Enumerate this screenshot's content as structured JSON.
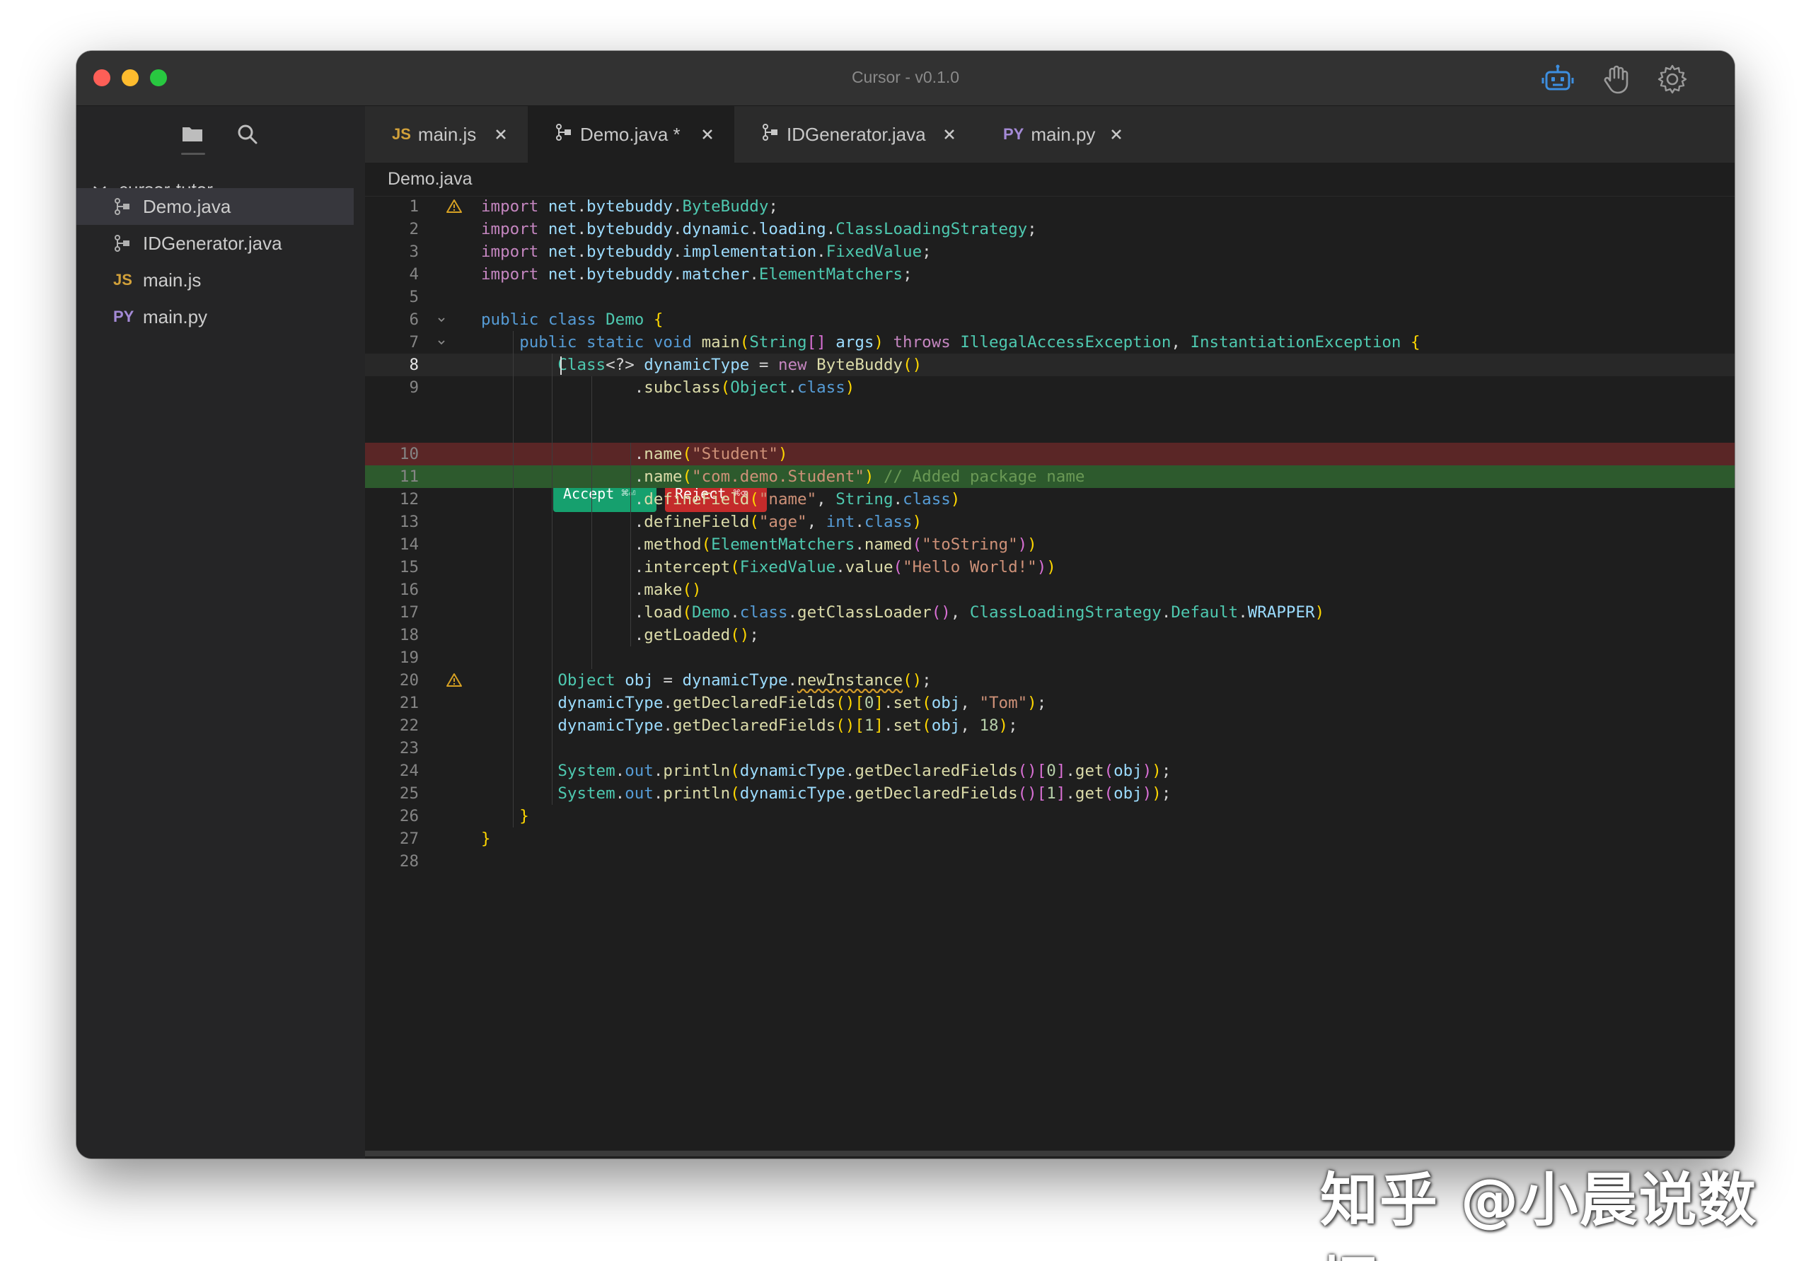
{
  "window": {
    "title": "Cursor - v0.1.0"
  },
  "titlebar_icons": [
    "robot-icon",
    "hand-icon",
    "gear-icon"
  ],
  "sidebar": {
    "root": "cursor-tutor",
    "items": [
      {
        "label": "Demo.java",
        "icon": "java-git-icon",
        "active": true
      },
      {
        "label": "IDGenerator.java",
        "icon": "java-git-icon"
      },
      {
        "label": "main.js",
        "badge": "JS"
      },
      {
        "label": "main.py",
        "badge": "PY"
      }
    ]
  },
  "tabs": [
    {
      "label": "main.js",
      "badge": "JS"
    },
    {
      "label": "Demo.java *",
      "icon": "java-git-icon",
      "active": true
    },
    {
      "label": "IDGenerator.java",
      "icon": "java-git-icon"
    },
    {
      "label": "main.py",
      "badge": "PY"
    }
  ],
  "breadcrumb": "Demo.java",
  "diff_actions": {
    "accept": "Accept",
    "accept_kbd": "⌘⏎",
    "reject": "Reject",
    "reject_kbd": "⌘⌫"
  },
  "editor": {
    "current_line": 8,
    "deleted_lines": [
      10
    ],
    "added_lines": [
      11
    ],
    "warning_lines": [
      1,
      20
    ],
    "fold_lines": [
      6,
      7
    ],
    "lines": [
      {
        "n": "1",
        "code": "import net.bytebuddy.ByteBuddy;"
      },
      {
        "n": "2",
        "code": "import net.bytebuddy.dynamic.loading.ClassLoadingStrategy;"
      },
      {
        "n": "3",
        "code": "import net.bytebuddy.implementation.FixedValue;"
      },
      {
        "n": "4",
        "code": "import net.bytebuddy.matcher.ElementMatchers;"
      },
      {
        "n": "5",
        "code": ""
      },
      {
        "n": "6",
        "code": "public class Demo {"
      },
      {
        "n": "7",
        "code": "    public static void main(String[] args) throws IllegalAccessException, InstantiationException {"
      },
      {
        "n": "8",
        "code": "        Class<?> dynamicType = new ByteBuddy()"
      },
      {
        "n": "9",
        "code": "                .subclass(Object.class)"
      },
      {
        "n": "10",
        "code": "                .name(\"Student\")"
      },
      {
        "n": "11",
        "code": "                .name(\"com.demo.Student\") // Added package name"
      },
      {
        "n": "12",
        "code": "                .defineField(\"name\", String.class)"
      },
      {
        "n": "13",
        "code": "                .defineField(\"age\", int.class)"
      },
      {
        "n": "14",
        "code": "                .method(ElementMatchers.named(\"toString\"))"
      },
      {
        "n": "15",
        "code": "                .intercept(FixedValue.value(\"Hello World!\"))"
      },
      {
        "n": "16",
        "code": "                .make()"
      },
      {
        "n": "17",
        "code": "                .load(Demo.class.getClassLoader(), ClassLoadingStrategy.Default.WRAPPER)"
      },
      {
        "n": "18",
        "code": "                .getLoaded();"
      },
      {
        "n": "19",
        "code": ""
      },
      {
        "n": "20",
        "code": "        Object obj = dynamicType.newInstance();"
      },
      {
        "n": "21",
        "code": "        dynamicType.getDeclaredFields()[0].set(obj, \"Tom\");"
      },
      {
        "n": "22",
        "code": "        dynamicType.getDeclaredFields()[1].set(obj, 18);"
      },
      {
        "n": "23",
        "code": ""
      },
      {
        "n": "24",
        "code": "        System.out.println(dynamicType.getDeclaredFields()[0].get(obj));"
      },
      {
        "n": "25",
        "code": "        System.out.println(dynamicType.getDeclaredFields()[1].get(obj));"
      },
      {
        "n": "26",
        "code": "    }"
      },
      {
        "n": "27",
        "code": "}"
      },
      {
        "n": "28",
        "code": ""
      }
    ]
  },
  "watermark": "知乎 @小晨说数据"
}
